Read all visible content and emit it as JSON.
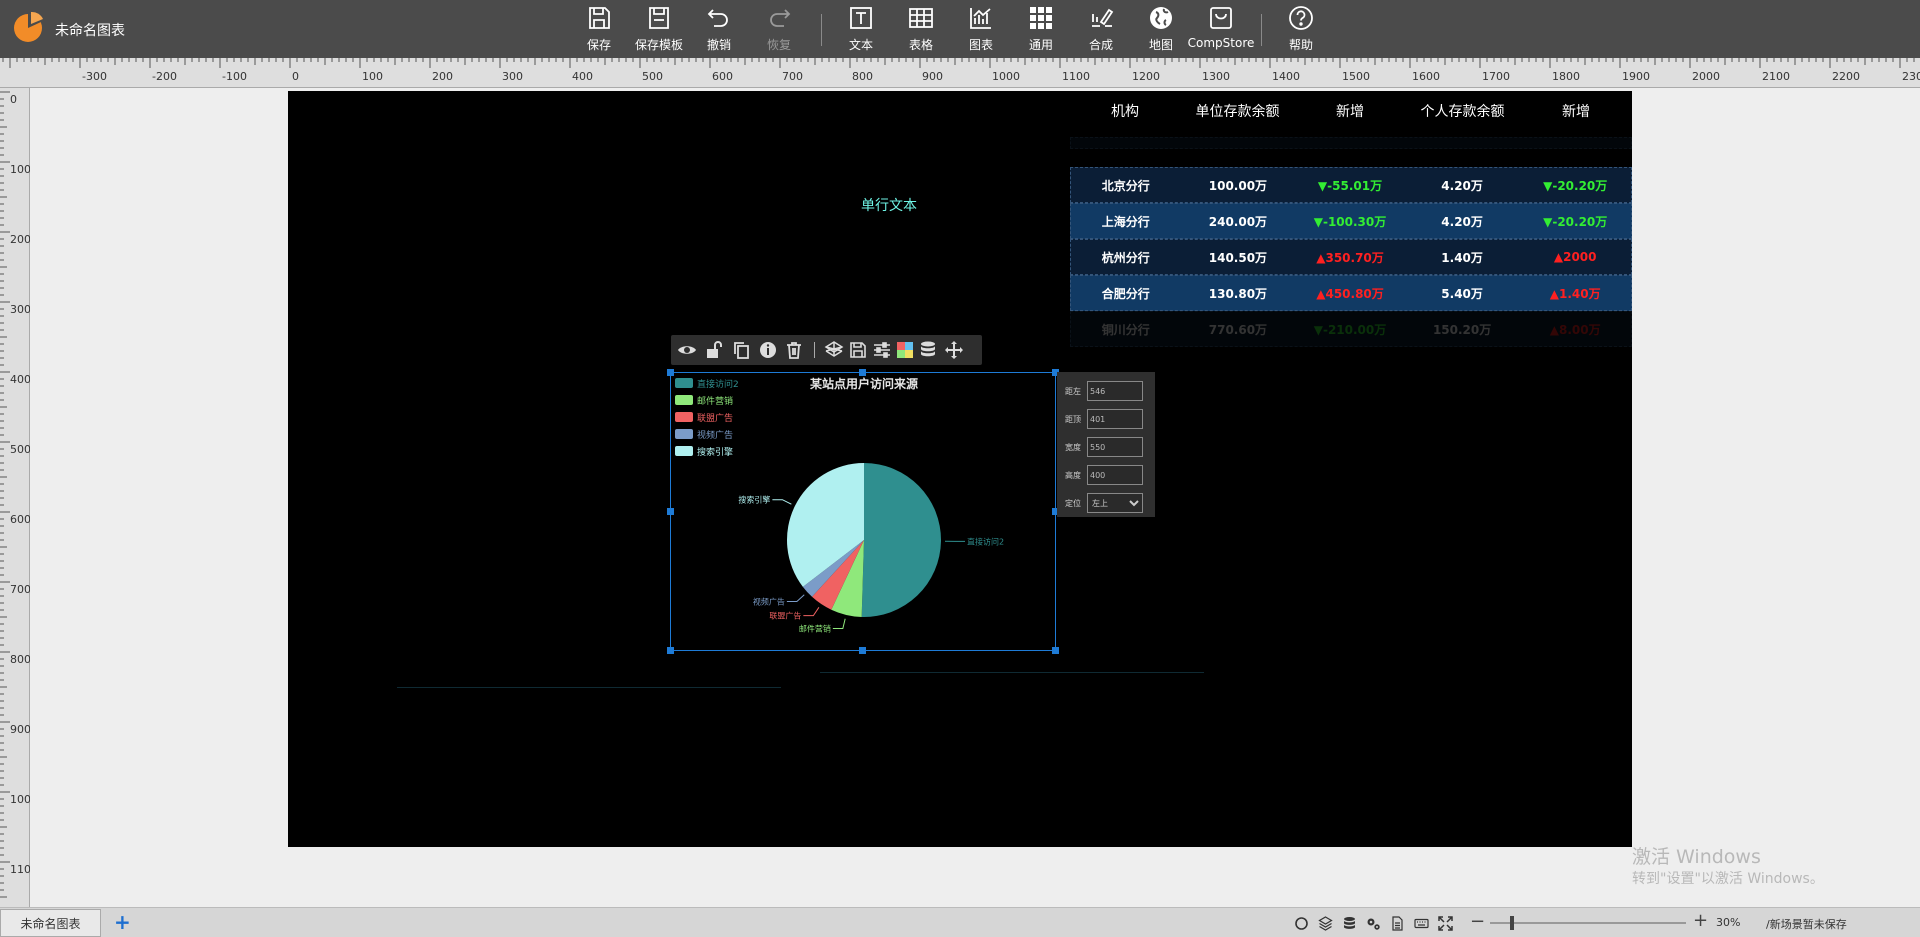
{
  "app": {
    "title": "未命名图表"
  },
  "toolbar": [
    {
      "label": "保存",
      "icon": "save-icon"
    },
    {
      "label": "保存模板",
      "icon": "save-template-icon"
    },
    {
      "label": "撤销",
      "icon": "undo-icon"
    },
    {
      "label": "恢复",
      "icon": "redo-icon",
      "disabled": true
    },
    {
      "label": "文本",
      "icon": "text-icon"
    },
    {
      "label": "表格",
      "icon": "table-icon"
    },
    {
      "label": "图表",
      "icon": "chart-icon"
    },
    {
      "label": "通用",
      "icon": "grid-icon"
    },
    {
      "label": "合成",
      "icon": "compose-icon"
    },
    {
      "label": "地图",
      "icon": "globe-icon"
    },
    {
      "label": "CompStore",
      "icon": "store-icon"
    },
    {
      "label": "帮助",
      "icon": "help-icon"
    }
  ],
  "ruler": {
    "h_labels": [
      "-300",
      "-200",
      "-100",
      "0",
      "100",
      "200",
      "300",
      "400",
      "500",
      "600",
      "700",
      "800",
      "900",
      "1000",
      "1100",
      "1200",
      "1300",
      "1400",
      "1500",
      "1600",
      "1700",
      "1800",
      "1900",
      "2000",
      "2100",
      "2200",
      "2300"
    ],
    "v_labels": [
      "0",
      "100",
      "200",
      "300",
      "400",
      "500",
      "600",
      "700",
      "800",
      "900",
      "1000",
      "1100"
    ]
  },
  "canvas": {
    "single_text": "单行文本"
  },
  "table": {
    "headers": [
      "机构",
      "单位存款余额",
      "新增",
      "个人存款余额",
      "新增"
    ],
    "rows": [
      {
        "inst": "北京分行",
        "unit": "100.00万",
        "unit_new": "▼-55.01万",
        "unit_dir": "down",
        "personal": "4.20万",
        "personal_new": "▼-20.20万",
        "personal_dir": "down",
        "style": "dark"
      },
      {
        "inst": "上海分行",
        "unit": "240.00万",
        "unit_new": "▼-100.30万",
        "unit_dir": "down",
        "personal": "4.20万",
        "personal_new": "▼-20.20万",
        "personal_dir": "down",
        "style": "light"
      },
      {
        "inst": "杭州分行",
        "unit": "140.50万",
        "unit_new": "▲350.70万",
        "unit_dir": "up",
        "personal": "1.40万",
        "personal_new": "▲2000",
        "personal_dir": "up",
        "style": "dark"
      },
      {
        "inst": "合肥分行",
        "unit": "130.80万",
        "unit_new": "▲450.80万",
        "unit_dir": "up",
        "personal": "5.40万",
        "personal_new": "▲1.40万",
        "personal_dir": "up",
        "style": "light"
      },
      {
        "inst": "铜川分行",
        "unit": "770.60万",
        "unit_new": "▼-210.00万",
        "unit_dir": "down",
        "personal": "150.20万",
        "personal_new": "▲8.00万",
        "personal_dir": "up",
        "style": "fade"
      }
    ]
  },
  "widget_toolbar": [
    "eye-icon",
    "unlock-icon",
    "copy-icon",
    "info-icon",
    "trash-icon",
    "layer-icon",
    "save-icon",
    "sliders-icon",
    "palette-icon",
    "database-icon",
    "move-icon"
  ],
  "chart_data": {
    "type": "pie",
    "title": "某站点用户访问来源",
    "categories": [
      "直接访问2",
      "邮件营销",
      "联盟广告",
      "视频广告",
      "搜索引擎"
    ],
    "values": [
      1048,
      135,
      100,
      58,
      735
    ],
    "colors": [
      "#2f8f8f",
      "#8fe87b",
      "#f06262",
      "#7b9cc8",
      "#b0f0f0"
    ]
  },
  "properties": [
    {
      "label": "距左",
      "value": "546"
    },
    {
      "label": "距顶",
      "value": "401"
    },
    {
      "label": "宽度",
      "value": "550"
    },
    {
      "label": "高度",
      "value": "400"
    }
  ],
  "position": {
    "label": "定位",
    "value": "左上",
    "options": [
      "左上"
    ]
  },
  "watermark": {
    "line1": "激活 Windows",
    "line2": "转到\"设置\"以激活 Windows。"
  },
  "bottom": {
    "tab": "未命名图表",
    "add": "+",
    "icons": [
      "circle-icon",
      "layers-icon",
      "database-icon",
      "settings-icon",
      "document-icon",
      "keyboard-icon",
      "fullscreen-icon"
    ],
    "zoom_minus": "−",
    "zoom_plus": "+",
    "zoom": "30%",
    "status": "/新场景暂未保存"
  }
}
